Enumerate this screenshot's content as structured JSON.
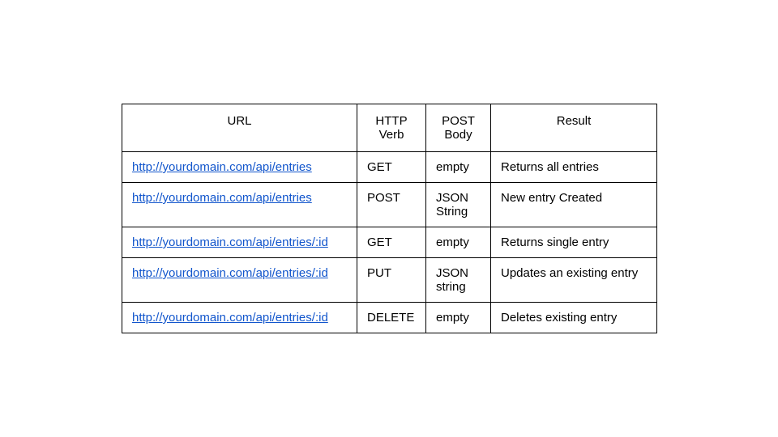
{
  "chart_data": {
    "type": "table",
    "headers": [
      "URL",
      "HTTP Verb",
      "POST Body",
      "Result"
    ],
    "rows": [
      {
        "url": "http://yourdomain.com/api/entries",
        "verb": "GET",
        "body": "empty",
        "result": "Returns all entries"
      },
      {
        "url": "http://yourdomain.com/api/entries",
        "verb": "POST",
        "body": "JSON String",
        "result": "New entry Created"
      },
      {
        "url": "http://yourdomain.com/api/entries/:id",
        "verb": "GET",
        "body": "empty",
        "result": "Returns single entry"
      },
      {
        "url": "http://yourdomain.com/api/entries/:id",
        "verb": "PUT",
        "body": "JSON string",
        "result": "Updates an existing entry"
      },
      {
        "url": "http://yourdomain.com/api/entries/:id",
        "verb": "DELETE",
        "body": "empty",
        "result": "Deletes existing entry"
      }
    ]
  },
  "headers": {
    "url": "URL",
    "verb": "HTTP Verb",
    "body": "POST Body",
    "result": "Result"
  },
  "rows": [
    {
      "url": "http://yourdomain.com/api/entries",
      "verb": "GET",
      "body": "empty",
      "result": "Returns all entries"
    },
    {
      "url": "http://yourdomain.com/api/entries",
      "verb": "POST",
      "body": "JSON String",
      "result": "New entry Created"
    },
    {
      "url": "http://yourdomain.com/api/entries/:id",
      "verb": "GET",
      "body": "empty",
      "result": "Returns single entry"
    },
    {
      "url": "http://yourdomain.com/api/entries/:id",
      "verb": "PUT",
      "body": "JSON string",
      "result": "Updates an existing entry"
    },
    {
      "url": "http://yourdomain.com/api/entries/:id",
      "verb": "DELETE",
      "body": "empty",
      "result": "Deletes existing entry"
    }
  ]
}
